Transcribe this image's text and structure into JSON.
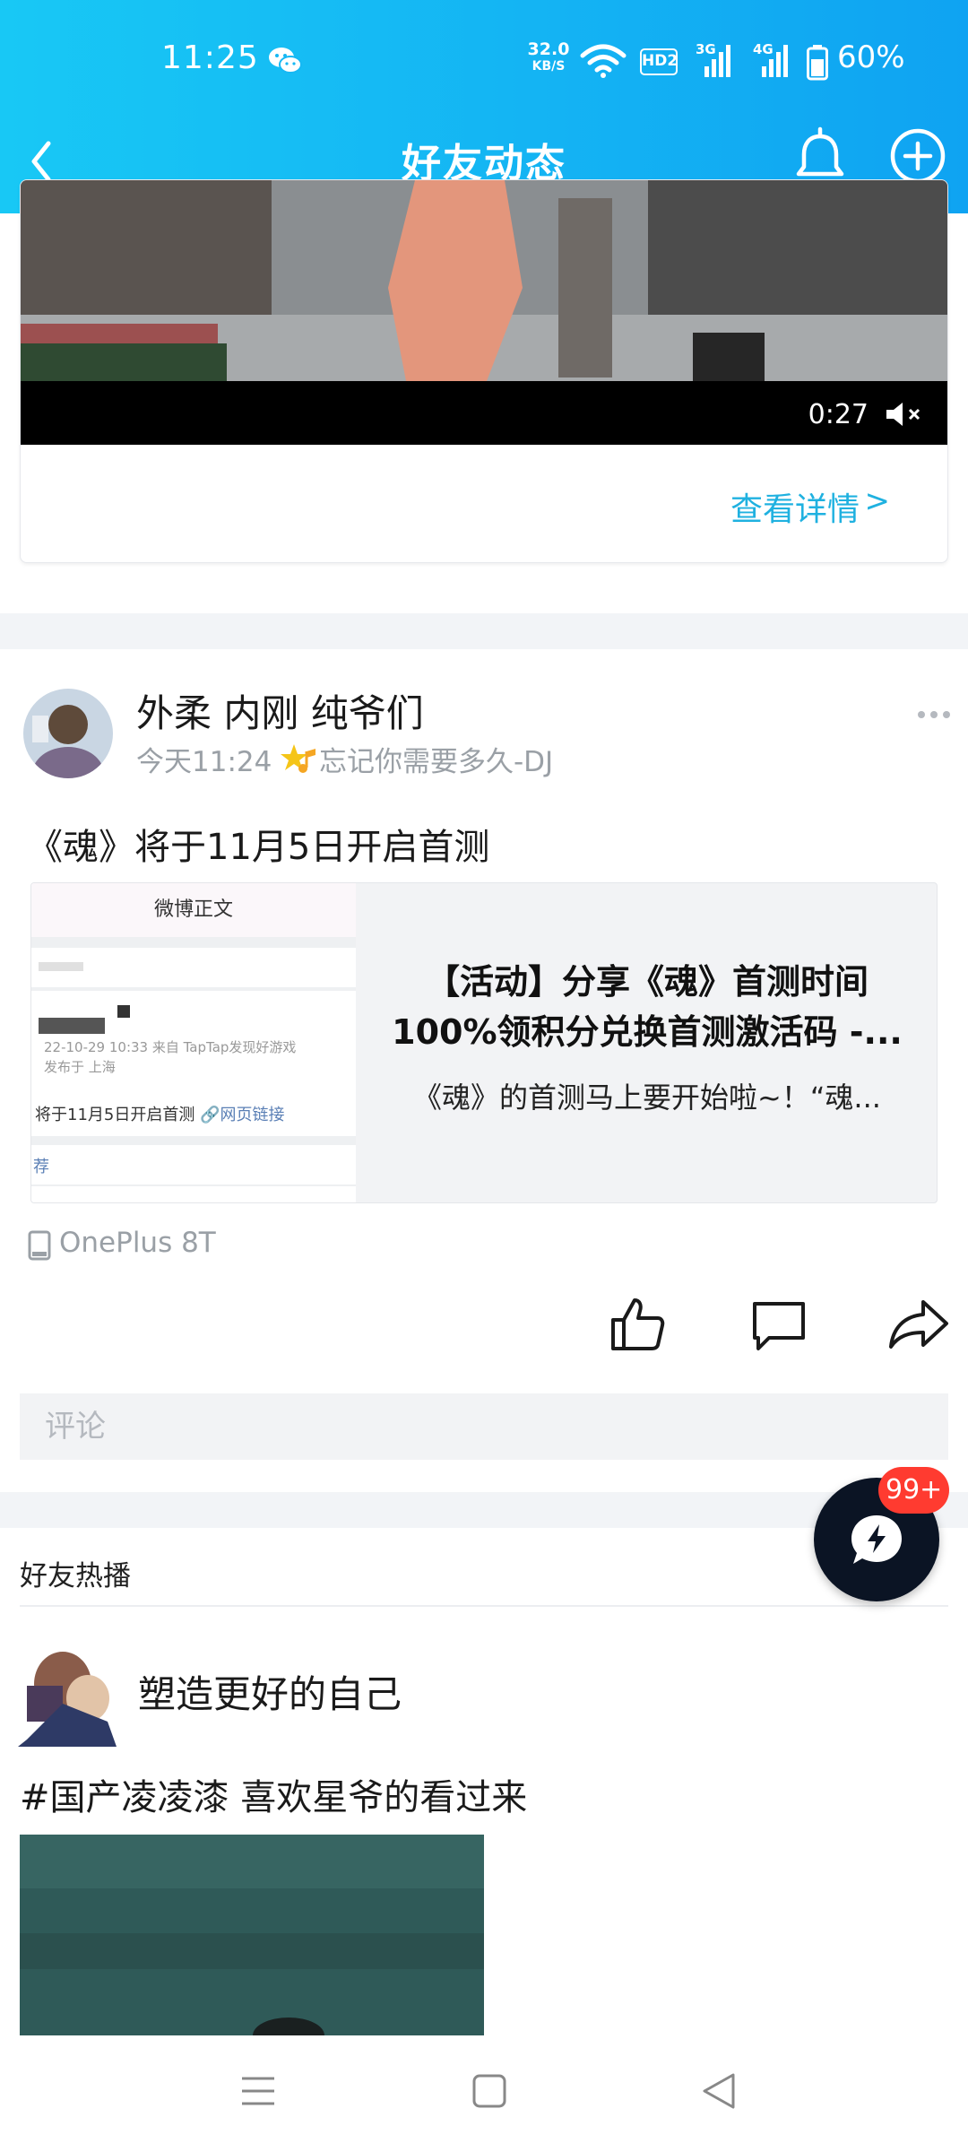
{
  "status_bar": {
    "time": "11:25",
    "net_speed_value": "32.0",
    "net_speed_unit": "KB/S",
    "hd_label": "HD2",
    "signal_1_label": "3G",
    "signal_2_label": "4G",
    "battery_text": "60%"
  },
  "nav": {
    "title": "好友动态",
    "icons": [
      "back-icon",
      "bell-icon",
      "add-circle-icon"
    ]
  },
  "video_card": {
    "duration": "0:27",
    "detail_link": "查看详情",
    "detail_arrow": ">"
  },
  "post": {
    "author": "外柔 内刚 纯爷们",
    "time": "今天11:24",
    "music": "忘记你需要多久-DJ",
    "text": "《魂》将于11月5日开启首测",
    "link_card": {
      "thumb_header": "微博正文",
      "thumb_meta_1": "22-10-29 10:33  来自 TapTap发现好游戏",
      "thumb_meta_2": "发布于 上海",
      "thumb_text": "将于11月5日开启首测",
      "thumb_link": "网页链接",
      "thumb_rec": "荐",
      "title_line1": "【活动】分享《魂》首测时间",
      "title_line2": "100%领积分兑换首测激活码 -...",
      "description": "《魂》的首测马上要开始啦~！“魂..."
    },
    "device": "OnePlus 8T",
    "comment_placeholder": "评论"
  },
  "fab": {
    "badge": "99+"
  },
  "hot": {
    "title": "好友热播"
  },
  "post2": {
    "author": "塑造更好的自己",
    "text": "#国产凌凌漆  喜欢星爷的看过来"
  },
  "colors": {
    "header_start": "#18c8f5",
    "header_end": "#0fa3f2",
    "accent_link": "#1fb1e0",
    "badge": "#ff3b30",
    "fab": "#0b1424",
    "muted_text": "#9aa0a6",
    "gap": "#f2f4f7"
  }
}
